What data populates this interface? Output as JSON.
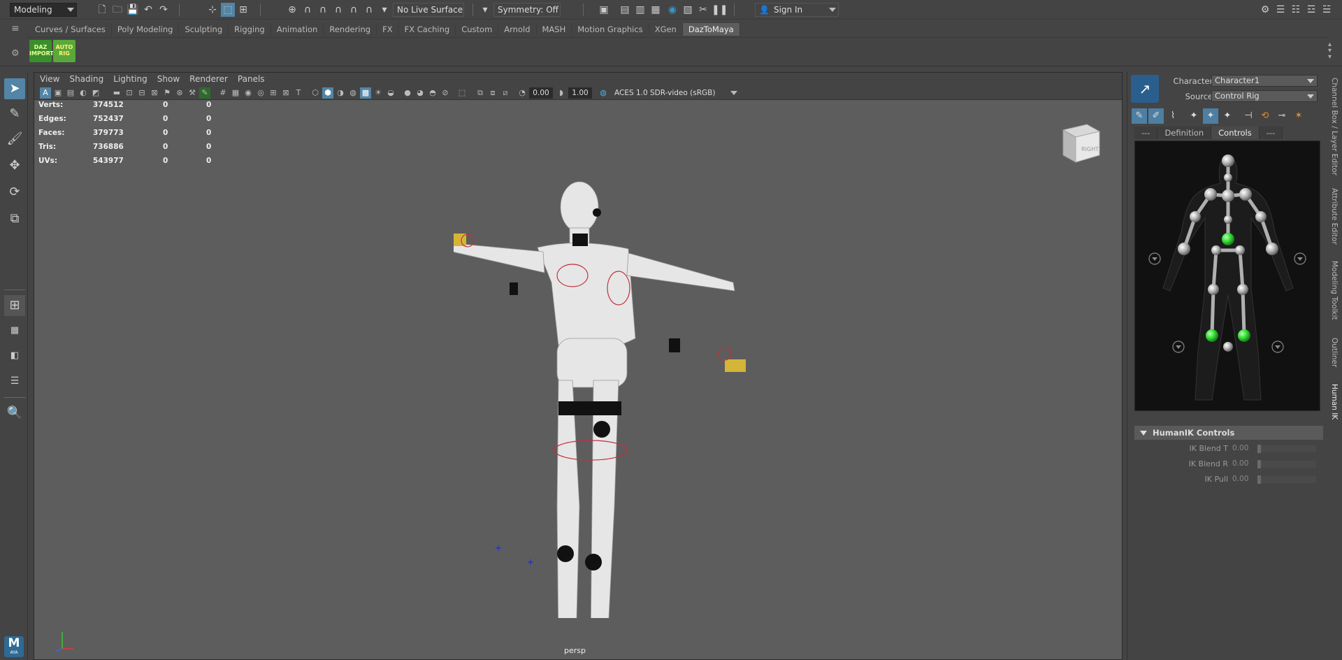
{
  "statusline": {
    "mode": "Modeling",
    "live_surface": "No Live Surface",
    "symmetry": "Symmetry: Off",
    "signin": "Sign In"
  },
  "shelf": {
    "tabs": [
      "Curves / Surfaces",
      "Poly Modeling",
      "Sculpting",
      "Rigging",
      "Animation",
      "Rendering",
      "FX",
      "FX Caching",
      "Custom",
      "Arnold",
      "MASH",
      "Motion Graphics",
      "XGen",
      "DazToMaya"
    ],
    "active_tab": "DazToMaya",
    "buttons": [
      {
        "label": "DAZ IMPORT",
        "color": "#3a8f2c"
      },
      {
        "label": "AUTO RIG",
        "color": "#5aa83a"
      }
    ]
  },
  "panel": {
    "menus": [
      "View",
      "Shading",
      "Lighting",
      "Show",
      "Renderer",
      "Panels"
    ],
    "exposure": "0.00",
    "gamma": "1.00",
    "colorspace": "ACES 1.0 SDR-video (sRGB)",
    "camera": "persp",
    "viewcube_label": "RIGHT"
  },
  "hud": {
    "rows": [
      {
        "label": "Verts:",
        "v1": "374512",
        "v2": "0",
        "v3": "0"
      },
      {
        "label": "Edges:",
        "v1": "752437",
        "v2": "0",
        "v3": "0"
      },
      {
        "label": "Faces:",
        "v1": "379773",
        "v2": "0",
        "v3": "0"
      },
      {
        "label": "Tris:",
        "v1": "736886",
        "v2": "0",
        "v3": "0"
      },
      {
        "label": "UVs:",
        "v1": "543977",
        "v2": "0",
        "v3": "0"
      }
    ]
  },
  "humanik": {
    "character_label": "Character:",
    "character_value": "Character1",
    "source_label": "Source:",
    "source_value": "Control Rig",
    "tabs": [
      "---",
      "Definition",
      "Controls",
      "---"
    ],
    "active_tab": "Controls",
    "section_title": "HumanIK Controls",
    "blends": [
      {
        "label": "IK Blend T",
        "value": "0.00"
      },
      {
        "label": "IK Blend R",
        "value": "0.00"
      },
      {
        "label": "IK Pull",
        "value": "0.00"
      }
    ]
  },
  "vertical_tabs": [
    "Channel Box / Layer Editor",
    "Attribute Editor",
    "Modeling Toolkit",
    "Outliner",
    "Human IK"
  ],
  "logo": {
    "text": "M",
    "sub": "AYA"
  },
  "colors": {
    "accent": "#5285a6",
    "background": "#444444",
    "viewport": "#5d5d5d",
    "hik_active": "#33dd33"
  }
}
